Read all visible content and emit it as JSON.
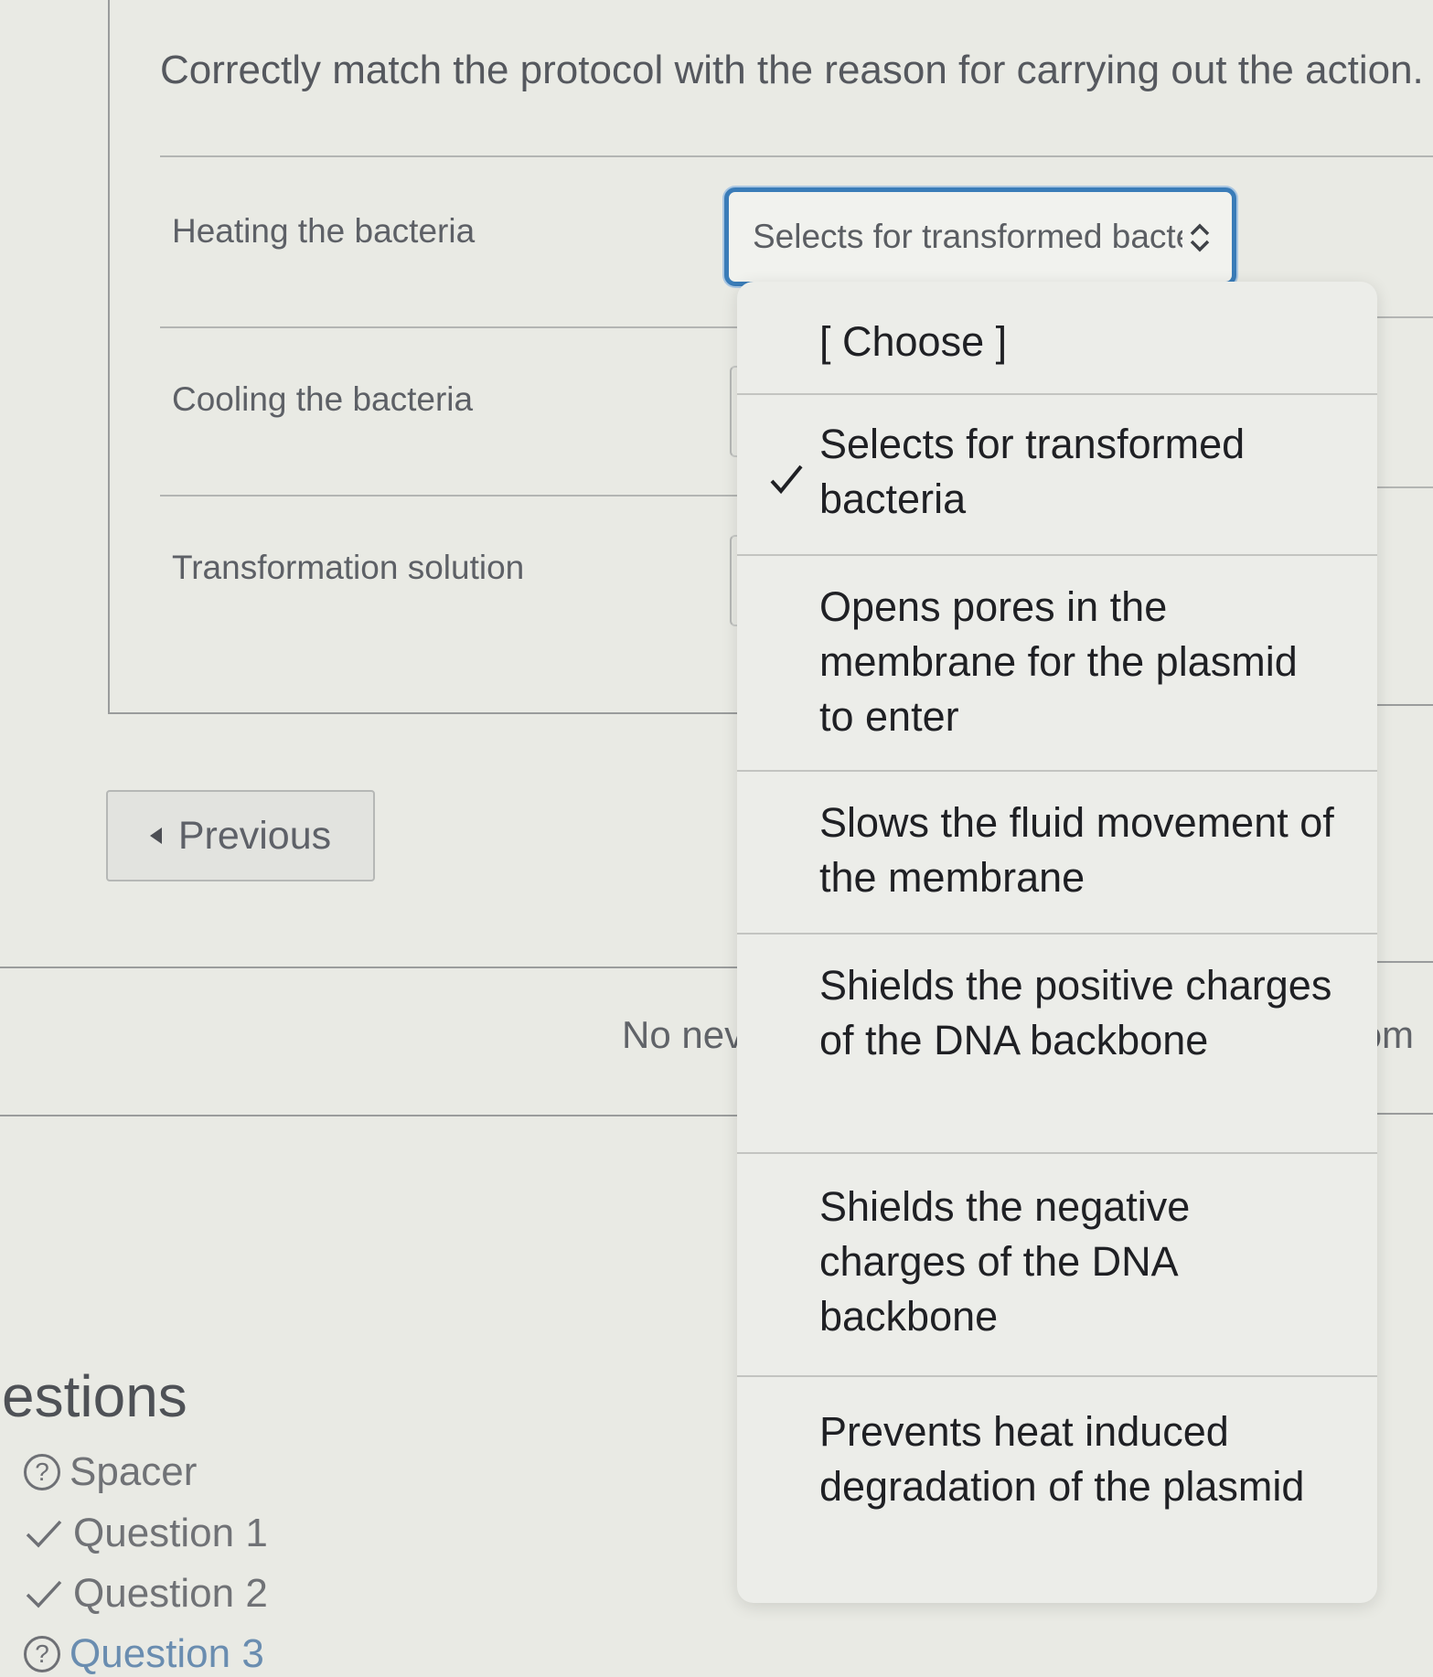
{
  "question": {
    "prompt": "Correctly match the protocol with the reason for carrying out the action."
  },
  "rows": [
    {
      "label": "Heating the bacteria",
      "selected": "Selects for transformed bacte"
    },
    {
      "label": "Cooling the bacteria"
    },
    {
      "label": "Transformation solution"
    }
  ],
  "dropdown": {
    "options": [
      {
        "text": "[ Choose ]",
        "checked": false
      },
      {
        "text": "Selects for transformed bacteria",
        "checked": true
      },
      {
        "text": "Opens pores in the membrane for the plasmid to enter",
        "checked": false
      },
      {
        "text": "Slows the fluid movement of the membrane",
        "checked": false
      },
      {
        "text": "Shields the positive charges of the DNA backbone",
        "checked": false
      },
      {
        "text": "Shields the negative charges of the DNA backbone",
        "checked": false
      },
      {
        "text": "Prevents heat induced degradation of the plasmid",
        "checked": false
      }
    ]
  },
  "nav": {
    "previous_label": "Previous",
    "partial_text_left": "No nev",
    "partial_text_right": "ɔm"
  },
  "sidebar": {
    "title": "estions",
    "items": [
      {
        "label": "Spacer",
        "status": "unanswered",
        "icon": "help-circle-icon"
      },
      {
        "label": "Question 1",
        "status": "answered",
        "icon": "check-icon"
      },
      {
        "label": "Question 2",
        "status": "answered",
        "icon": "check-icon"
      },
      {
        "label": "Question 3",
        "status": "unanswered",
        "icon": "help-circle-icon"
      }
    ]
  },
  "colors": {
    "focus_border": "#3a7cb8",
    "background": "#e9eae4",
    "dropdown_bg": "#ecede9"
  }
}
